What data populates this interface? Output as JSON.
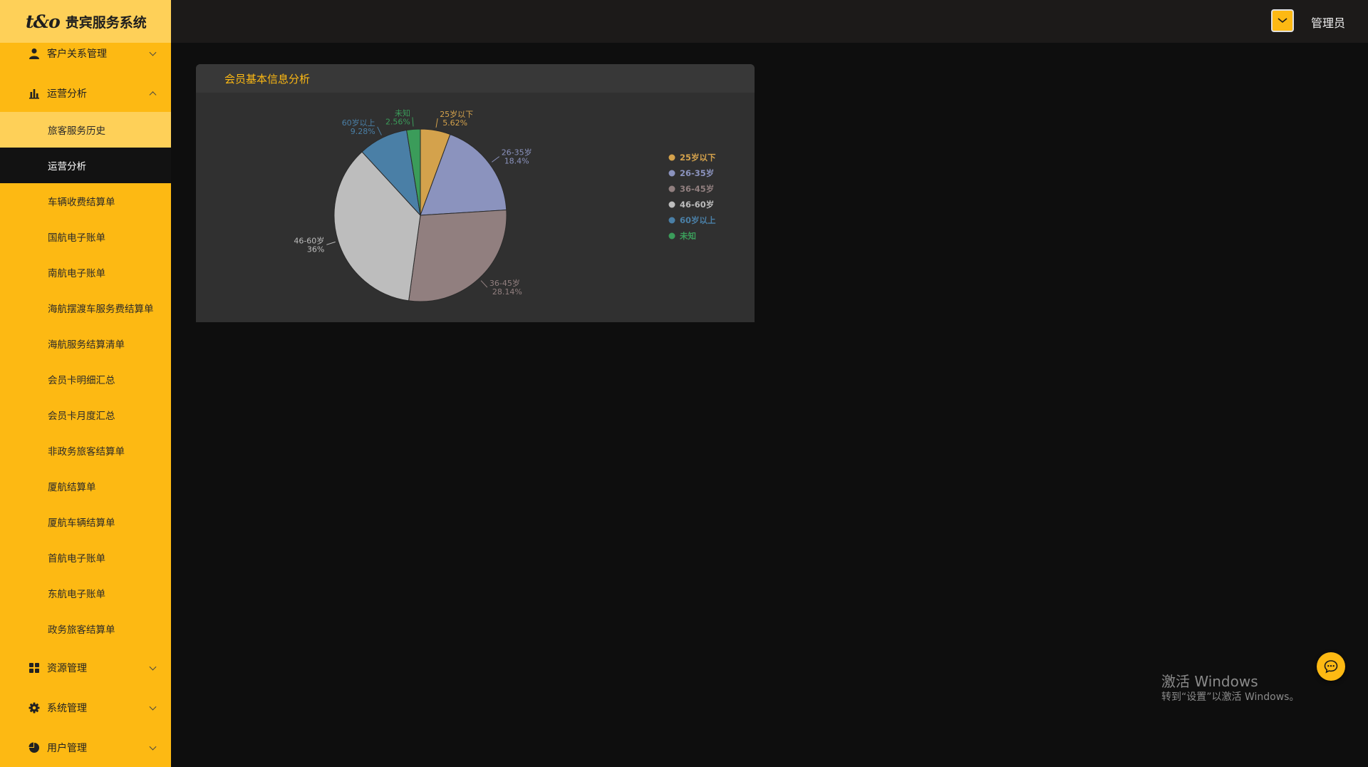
{
  "app": {
    "logo_text": "t&o",
    "title": "贵宾服务系统"
  },
  "sidebar": {
    "groups": {
      "crm": {
        "label": "客户关系管理",
        "icon": "user-icon"
      },
      "ops": {
        "label": "运营分析",
        "icon": "bar-chart-icon"
      },
      "resources": {
        "label": "资源管理",
        "icon": "grid-icon"
      },
      "system": {
        "label": "系统管理",
        "icon": "gear-icon"
      },
      "users": {
        "label": "用户管理",
        "icon": "pie-icon"
      }
    },
    "items": [
      {
        "label": "旅客服务历史"
      },
      {
        "label": "运营分析"
      },
      {
        "label": "车辆收费结算单"
      },
      {
        "label": "国航电子账单"
      },
      {
        "label": "南航电子账单"
      },
      {
        "label": "海航摆渡车服务费结算单"
      },
      {
        "label": "海航服务结算清单"
      },
      {
        "label": "会员卡明细汇总"
      },
      {
        "label": "会员卡月度汇总"
      },
      {
        "label": "非政务旅客结算单"
      },
      {
        "label": "厦航结算单"
      },
      {
        "label": "厦航车辆结算单"
      },
      {
        "label": "首航电子账单"
      },
      {
        "label": "东航电子账单"
      },
      {
        "label": "政务旅客结算单"
      }
    ]
  },
  "header": {
    "user_name": "管理员",
    "avatar_icon": "user-avatar-icon"
  },
  "card": {
    "title": "会员基本信息分析"
  },
  "chart_data": {
    "type": "pie",
    "title": "会员基本信息分析",
    "legend_position": "right",
    "series": [
      {
        "name": "25岁以下",
        "value": 5.62,
        "label": "5.62%",
        "color": "#d4a24c"
      },
      {
        "name": "26-35岁",
        "value": 18.4,
        "label": "18.4%",
        "color": "#8b93be"
      },
      {
        "name": "36-45岁",
        "value": 28.14,
        "label": "28.14%",
        "color": "#917f7f"
      },
      {
        "name": "46-60岁",
        "value": 36,
        "label": "36%",
        "color": "#bdbdbd"
      },
      {
        "name": "60岁以上",
        "value": 9.28,
        "label": "9.28%",
        "color": "#4a7fa6"
      },
      {
        "name": "未知",
        "value": 2.56,
        "label": "2.56%",
        "color": "#3b9c5a"
      }
    ]
  },
  "watermark": {
    "title": "激活 Windows",
    "subtitle": "转到“设置”以激活 Windows。"
  },
  "chat": {
    "icon": "chat-bubble-icon"
  },
  "colors": {
    "sidebar_bg": "#fdb913",
    "sidebar_highlight": "#fed058",
    "active_item_bg": "#121212",
    "topbar_bg": "#1c1a19",
    "page_bg": "#0e0e0e",
    "card_bg": "#303030",
    "accent": "#fdb913"
  }
}
